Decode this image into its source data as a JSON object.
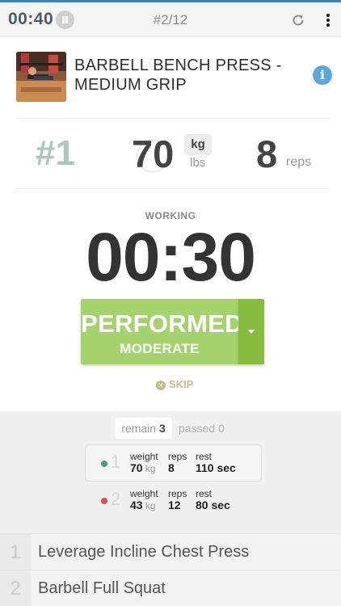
{
  "topbar": {
    "timer": "00:40",
    "counter": "#2/12"
  },
  "exercise": {
    "title": "BARBELL BENCH PRESS - MEDIUM GRIP"
  },
  "set": {
    "number": "#1",
    "weight": "70",
    "unit_selected": "kg",
    "unit_alt": "lbs",
    "reps": "8",
    "reps_label": "reps"
  },
  "timer": {
    "status": "WORKING",
    "value": "00:30"
  },
  "action": {
    "main_label": "PERFORMED",
    "sub_label": "MODERATE",
    "skip_label": "SKIP"
  },
  "progress": {
    "remain_label": "remain",
    "remain_count": "3",
    "passed_label": "passed 0"
  },
  "sets": [
    {
      "index": "1",
      "weight_label": "weight",
      "weight": "70",
      "weight_unit": "kg",
      "reps_label": "reps",
      "reps": "8",
      "rest_label": "rest",
      "rest": "110 sec",
      "dot_color": "#4a9a7a"
    },
    {
      "index": "2",
      "weight_label": "weight",
      "weight": "43",
      "weight_unit": "kg",
      "reps_label": "reps",
      "reps": "12",
      "rest_label": "rest",
      "rest": "80 sec",
      "dot_color": "#d9534f"
    }
  ],
  "next_exercises": [
    {
      "num": "1",
      "name": "Leverage Incline Chest Press"
    },
    {
      "num": "2",
      "name": "Barbell Full Squat"
    }
  ],
  "colors": {
    "accent_green": "#a4d36e",
    "accent_green_dark": "#86bc40",
    "info_blue": "#5aa7de",
    "header_line": "#3d7fb8"
  }
}
